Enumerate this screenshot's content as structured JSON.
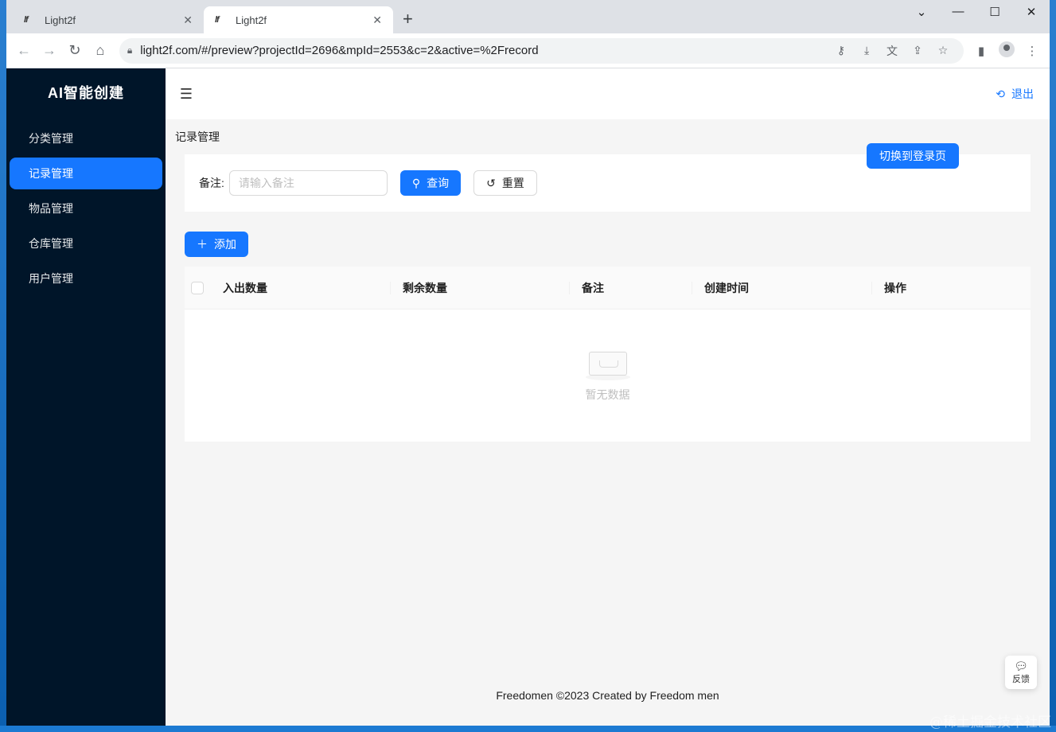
{
  "browser": {
    "tabs": [
      {
        "favicon": "lf",
        "title": "Light2f"
      },
      {
        "favicon": "lf",
        "title": "Light2f"
      }
    ],
    "url": "light2f.com/#/preview?projectId=2696&mpId=2553&c=2&active=%2Frecord"
  },
  "app": {
    "logo": "AI智能创建",
    "menu": [
      {
        "label": "分类管理",
        "active": false
      },
      {
        "label": "记录管理",
        "active": true
      },
      {
        "label": "物品管理",
        "active": false
      },
      {
        "label": "仓库管理",
        "active": false
      },
      {
        "label": "用户管理",
        "active": false
      }
    ],
    "header": {
      "logout_label": "退出"
    },
    "page_title": "记录管理",
    "switch_button": "切换到登录页",
    "search": {
      "label": "备注:",
      "placeholder": "请输入备注",
      "query_button": "查询",
      "reset_button": "重置"
    },
    "add_button": "添加",
    "table": {
      "columns": [
        "入出数量",
        "剩余数量",
        "备注",
        "创建时间",
        "操作"
      ],
      "empty_text": "暂无数据"
    },
    "footer": "Freedomen ©2023 Created by Freedom men",
    "feedback_label": "反馈"
  },
  "watermark": "@稀土掘金技术社区",
  "colors": {
    "primary": "#1677ff",
    "sidebar": "#001529"
  }
}
